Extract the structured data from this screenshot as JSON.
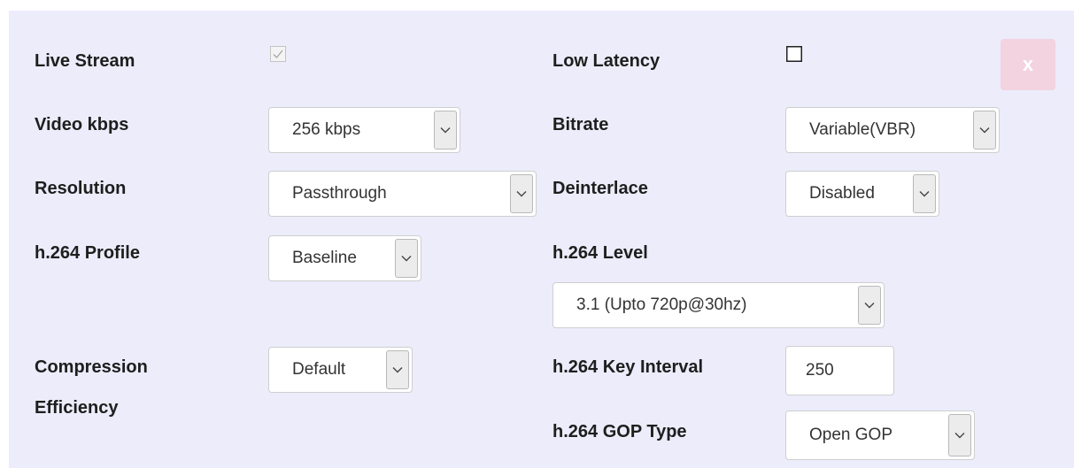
{
  "fields": {
    "live_stream": {
      "label": "Live Stream",
      "checked": true,
      "disabled": true
    },
    "low_latency": {
      "label": "Low Latency",
      "checked": false
    },
    "video_kbps": {
      "label": "Video kbps",
      "value": "256 kbps"
    },
    "bitrate": {
      "label": "Bitrate",
      "value": "Variable(VBR)"
    },
    "resolution": {
      "label": "Resolution",
      "value": "Passthrough"
    },
    "deinterlace": {
      "label": "Deinterlace",
      "value": "Disabled"
    },
    "h264_profile": {
      "label": "h.264 Profile",
      "value": "Baseline"
    },
    "h264_level": {
      "label": "h.264 Level",
      "value": "3.1 (Upto 720p@30hz)"
    },
    "compression_efficiency": {
      "label_line1": "Compression",
      "label_line2": "Efficiency",
      "value": "Default"
    },
    "h264_key_interval": {
      "label": "h.264 Key Interval",
      "value": "250"
    },
    "h264_gop_type": {
      "label": "h.264 GOP Type",
      "value": "Open GOP"
    }
  },
  "close_button": {
    "label": "x"
  },
  "colors": {
    "panel_bg": "#ececfb",
    "close_bg": "#f2d3df",
    "label_text": "#1e1e1e",
    "arrow_bg": "#ececec"
  },
  "icons": {
    "dropdown": "chevron-down-icon",
    "checkbox_checked": "checkmark-icon"
  }
}
